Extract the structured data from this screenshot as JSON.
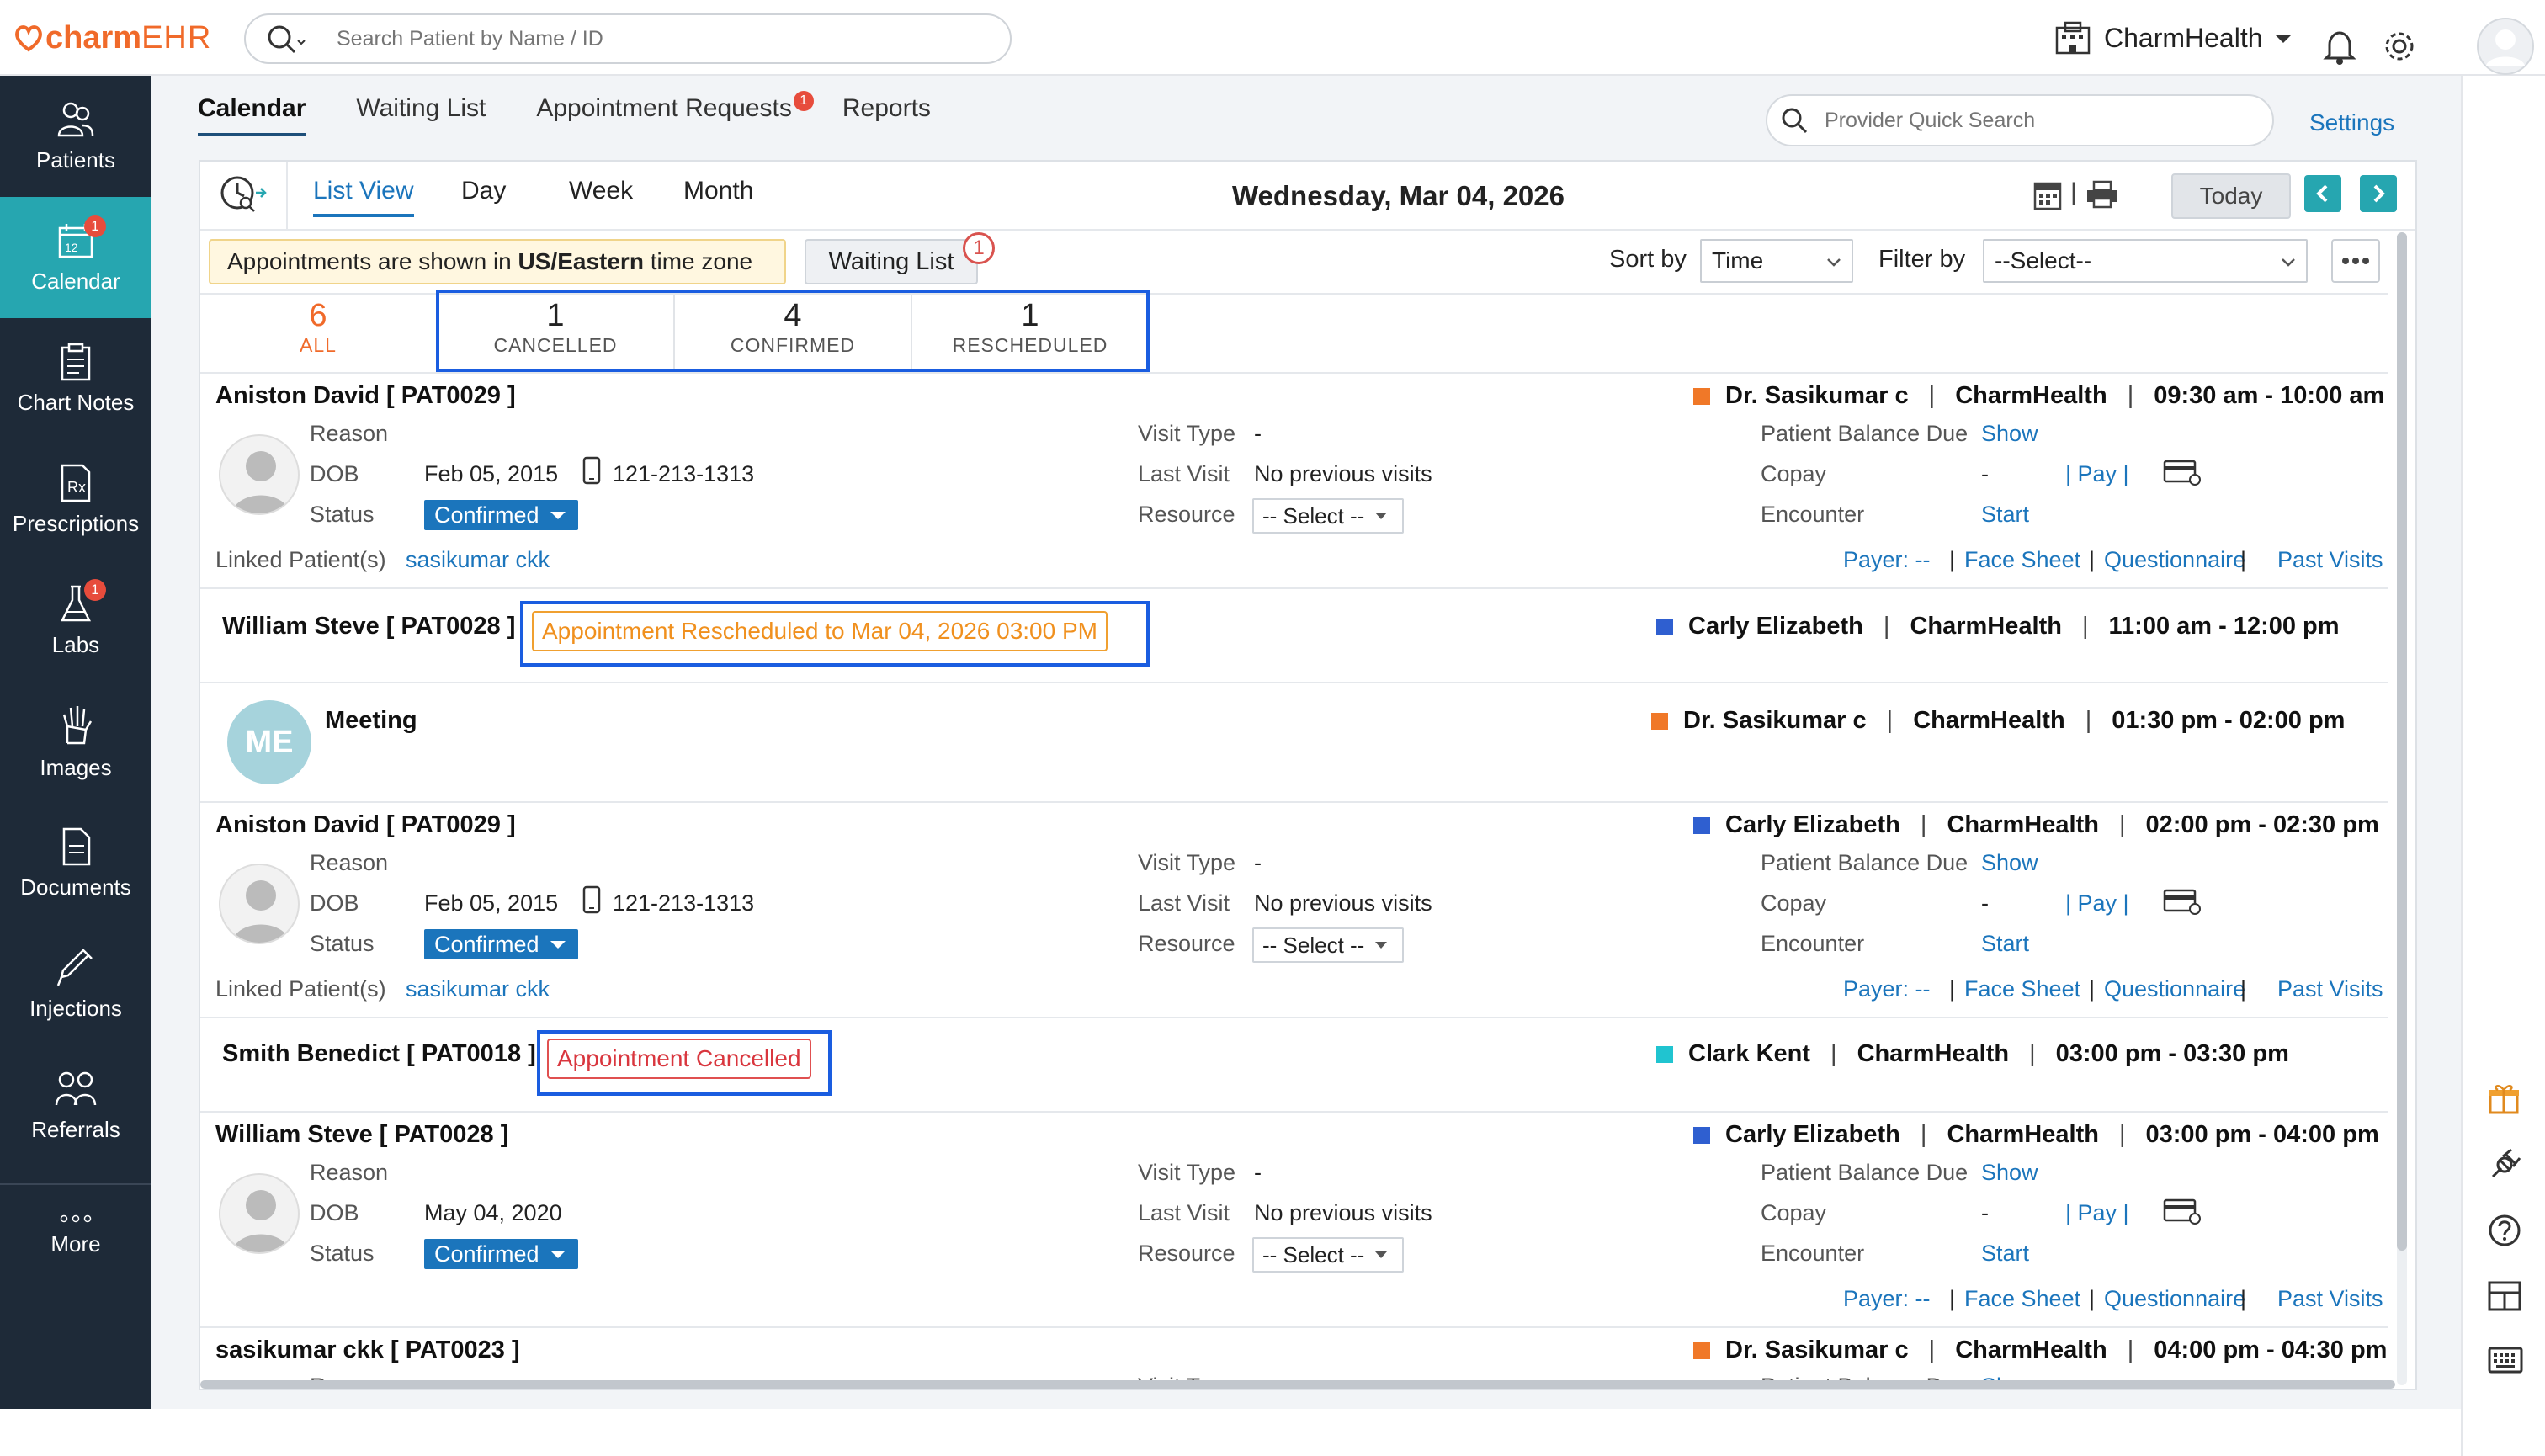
{
  "app": {
    "logo_prefix": "charm",
    "logo_suffix": "EHR",
    "search_placeholder": "Search Patient by Name / ID",
    "org_name": "CharmHealth"
  },
  "sidebar": {
    "items": [
      {
        "label": "Patients",
        "icon": "patients-icon",
        "badge": ""
      },
      {
        "label": "Calendar",
        "icon": "calendar-icon",
        "badge": "1",
        "active": true
      },
      {
        "label": "Chart Notes",
        "icon": "chart-notes-icon",
        "badge": ""
      },
      {
        "label": "Prescriptions",
        "icon": "prescription-icon",
        "badge": ""
      },
      {
        "label": "Labs",
        "icon": "labs-flask-icon",
        "badge": "1"
      },
      {
        "label": "Images",
        "icon": "xray-hand-icon",
        "badge": ""
      },
      {
        "label": "Documents",
        "icon": "documents-icon",
        "badge": ""
      },
      {
        "label": "Injections",
        "icon": "syringe-icon",
        "badge": ""
      },
      {
        "label": "Referrals",
        "icon": "referrals-icon",
        "badge": ""
      },
      {
        "label": "More",
        "icon": "more-dots-icon",
        "badge": ""
      }
    ]
  },
  "tabs": {
    "items": [
      {
        "label": "Calendar"
      },
      {
        "label": "Waiting List"
      },
      {
        "label": "Appointment Requests",
        "badge": "1"
      },
      {
        "label": "Reports"
      }
    ],
    "provider_search_placeholder": "Provider Quick Search",
    "settings": "Settings"
  },
  "toolbar": {
    "views": [
      "List View",
      "Day",
      "Week",
      "Month"
    ],
    "date": "Wednesday, Mar 04, 2026",
    "today": "Today",
    "tz_prefix": "Appointments are shown in ",
    "tz_bold": "US/Eastern",
    "tz_suffix": " time zone",
    "waiting_list": "Waiting List",
    "waiting_badge": "1",
    "sort_label": "Sort by",
    "sort_value": "Time",
    "filter_label": "Filter by",
    "filter_value": "--Select--"
  },
  "counts": [
    {
      "n": "6",
      "label": "ALL"
    },
    {
      "n": "1",
      "label": "CANCELLED"
    },
    {
      "n": "4",
      "label": "CONFIRMED"
    },
    {
      "n": "1",
      "label": "RESCHEDULED"
    }
  ],
  "labels": {
    "reason": "Reason",
    "dob": "DOB",
    "status": "Status",
    "visit_type": "Visit Type",
    "last_visit": "Last Visit",
    "resource": "Resource",
    "balance": "Patient Balance Due",
    "copay": "Copay",
    "encounter": "Encounter",
    "show": "Show",
    "pay": "Pay",
    "start": "Start",
    "linked": "Linked Patient(s)",
    "dash": "-",
    "no_prev": "No previous visits",
    "select": "-- Select --",
    "confirmed": "Confirmed",
    "payer": "Payer: --",
    "face": "Face Sheet",
    "quest": "Questionnaire",
    "past": "Past Visits",
    "sep": "|",
    "sep_pay": "| Pay |"
  },
  "appointments": [
    {
      "name": "Aniston David  [ PAT0029 ]",
      "dob": "Feb 05, 2015",
      "phone": "121-213-1313",
      "linked": "sasikumar ckk",
      "provider": "Dr. Sasikumar c",
      "provider_color": "#f07828",
      "facility": "CharmHealth",
      "time": "09:30 am - 10:00 am"
    },
    {
      "name": "William Steve  [ PAT0028 ]",
      "status_msg": "Appointment Rescheduled to Mar 04, 2026 03:00 PM",
      "provider": "Carly Elizabeth",
      "provider_color": "#2f5fd0",
      "facility": "CharmHealth",
      "time": "11:00 am - 12:00 pm"
    },
    {
      "name": "Meeting",
      "initials": "ME",
      "provider": "Dr. Sasikumar c",
      "provider_color": "#f07828",
      "facility": "CharmHealth",
      "time": "01:30 pm - 02:00 pm"
    },
    {
      "name": "Aniston David  [ PAT0029 ]",
      "dob": "Feb 05, 2015",
      "phone": "121-213-1313",
      "linked": "sasikumar ckk",
      "provider": "Carly Elizabeth",
      "provider_color": "#2f5fd0",
      "facility": "CharmHealth",
      "time": "02:00 pm - 02:30 pm"
    },
    {
      "name": "Smith Benedict  [ PAT0018 ]",
      "status_msg": "Appointment Cancelled",
      "provider": "Clark Kent",
      "provider_color": "#20c4d0",
      "facility": "CharmHealth",
      "time": "03:00 pm - 03:30 pm"
    },
    {
      "name": "William Steve  [ PAT0028 ]",
      "dob": "May 04, 2020",
      "provider": "Carly Elizabeth",
      "provider_color": "#2f5fd0",
      "facility": "CharmHealth",
      "time": "03:00 pm - 04:00 pm"
    },
    {
      "name": "sasikumar ckk  [ PAT0023 ]",
      "provider": "Dr. Sasikumar c",
      "provider_color": "#f07828",
      "facility": "CharmHealth",
      "time": "04:00 pm - 04:30 pm"
    }
  ]
}
